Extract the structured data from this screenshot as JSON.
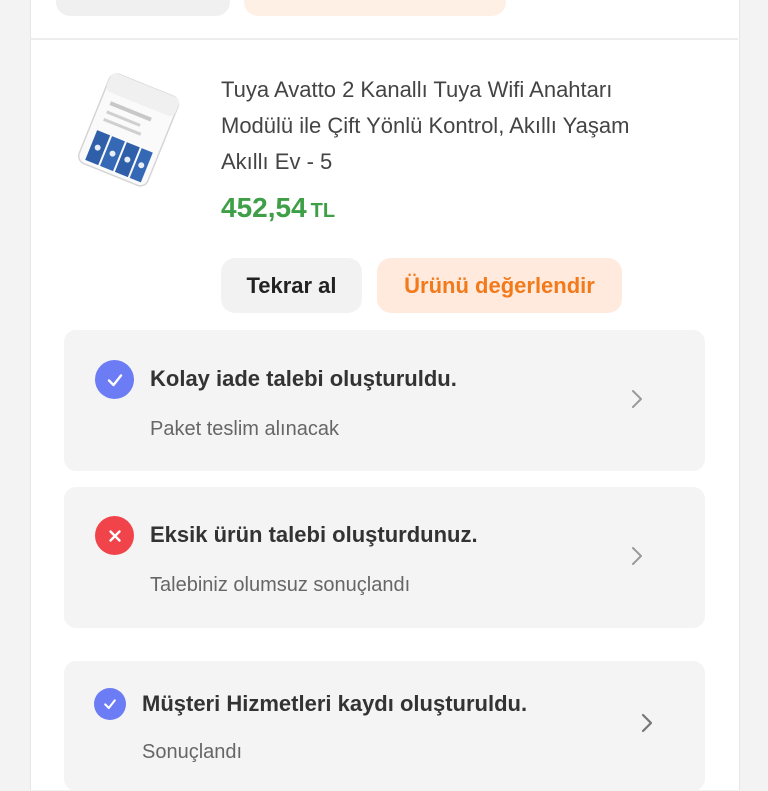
{
  "product": {
    "title_line1": "Tuya Avatto 2 Kanallı Tuya Wifi Anahtarı",
    "title_line2": "Modülü ile Çift Yönlü Kontrol, Akıllı Yaşam",
    "title_line3": "Akıllı Ev - 5",
    "price": "452,54",
    "currency": "TL"
  },
  "actions": {
    "rebuy_label": "Tekrar al",
    "review_label": "Ürünü değerlendir"
  },
  "statuses": [
    {
      "icon": "check-circle-icon",
      "color": "#6b7cf5",
      "title": "Kolay iade talebi oluşturuldu.",
      "subtitle": "Paket teslim alınacak"
    },
    {
      "icon": "x-circle-icon",
      "color": "#f0444a",
      "title": "Eksik ürün talebi oluşturdunuz.",
      "subtitle": "Talebiniz olumsuz sonuçlandı"
    },
    {
      "icon": "check-circle-icon",
      "color": "#6b7cf5",
      "title": "Müşteri Hizmetleri kaydı oluşturuldu.",
      "subtitle": "Sonuçlandı"
    }
  ],
  "colors": {
    "price_green": "#3f9f47",
    "accent_orange": "#f27a1a",
    "review_bg": "#ffeadd"
  }
}
